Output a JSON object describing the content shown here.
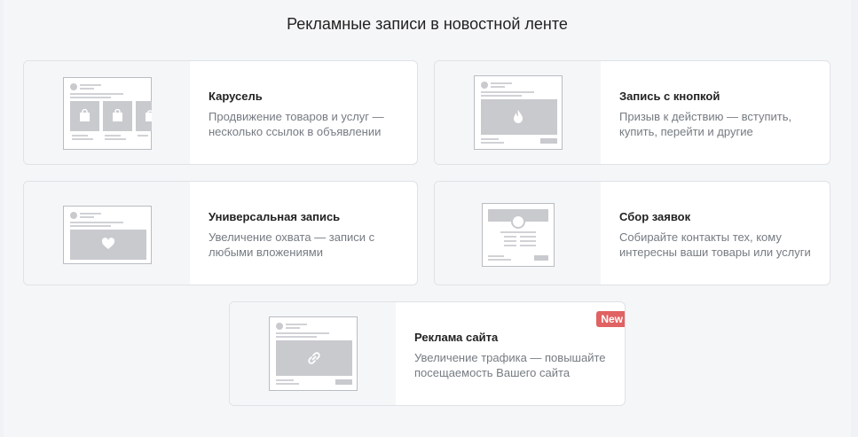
{
  "section": {
    "title": "Рекламные записи в новостной ленте"
  },
  "cards": [
    {
      "title": "Карусель",
      "description": "Продвижение товаров и услуг — несколько ссылок в объявлении",
      "icon": "carousel-preview-icon"
    },
    {
      "title": "Запись с кнопкой",
      "description": "Призыв к действию — вступить, купить, перейти и другие",
      "icon": "button-post-preview-icon"
    },
    {
      "title": "Универсальная запись",
      "description": "Увеличение охвата — записи с любыми вложениями",
      "icon": "universal-post-preview-icon"
    },
    {
      "title": "Сбор заявок",
      "description": "Собирайте контакты тех, кому интересны ваши товары или услуги",
      "icon": "lead-form-preview-icon"
    },
    {
      "title": "Реклама сайта",
      "description": "Увеличение трафика — повышайте посещаемость Вашего сайта",
      "icon": "website-ad-preview-icon",
      "badge": "New"
    }
  ]
}
